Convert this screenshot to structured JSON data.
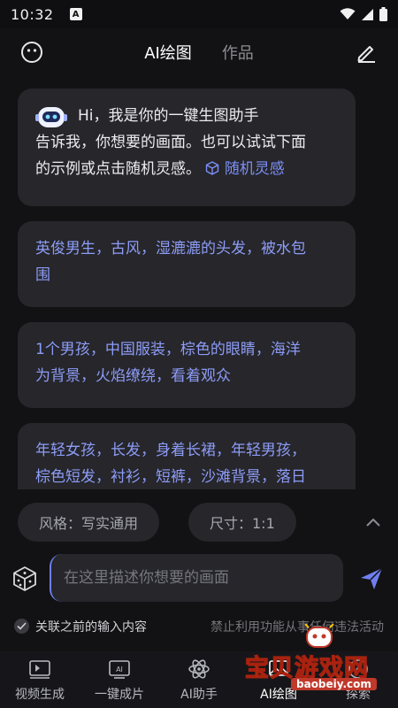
{
  "status_bar": {
    "time": "10:32",
    "notification_letter": "A"
  },
  "header": {
    "tabs": [
      {
        "label": "AI绘图",
        "active": true
      },
      {
        "label": "作品",
        "active": false
      }
    ],
    "left_icon": "smiley-icon",
    "right_icon": "edit-pen-icon"
  },
  "chat": {
    "greeting": {
      "title": "Hi，我是你的一键生图助手",
      "line2": "告诉我，你想要的画面。也可以试试下面",
      "line3": "的示例或点击随机灵感。",
      "inspire_label": "随机灵感"
    },
    "examples": [
      {
        "line1": "英俊男生，古风，湿漉漉的头发，被水包",
        "line2": "围"
      },
      {
        "line1": "1个男孩，中国服装，棕色的眼睛，海洋",
        "line2": "为背景，火焰缭绕，看着观众"
      },
      {
        "line1": "年轻女孩，长发，身着长裙，年轻男孩，",
        "line2": "棕色短发，衬衫，短裤，沙滩背景，落日"
      }
    ]
  },
  "options": {
    "style_label": "风格：写实通用",
    "size_label": "尺寸：1:1"
  },
  "input": {
    "placeholder": "在这里描述你想要的画面",
    "value": ""
  },
  "footer": {
    "link_previous_label": "关联之前的输入内容",
    "notice": "禁止利用功能从事任何违法活动"
  },
  "bottom_nav": [
    {
      "label": "视频生成",
      "icon": "video-ai-icon",
      "active": false
    },
    {
      "label": "一键成片",
      "icon": "clip-ai-icon",
      "active": false
    },
    {
      "label": "AI助手",
      "icon": "atom-icon",
      "active": false
    },
    {
      "label": "AI绘图",
      "icon": "paint-icon",
      "active": true
    },
    {
      "label": "探索",
      "icon": "explore-icon",
      "active": false
    }
  ],
  "watermark": {
    "text": "宝贝游戏网",
    "url": "baobeiy.com"
  },
  "colors": {
    "background": "#121214",
    "bubble": "#26262b",
    "accent": "#7c8ff5",
    "send": "#6f7ff0"
  }
}
